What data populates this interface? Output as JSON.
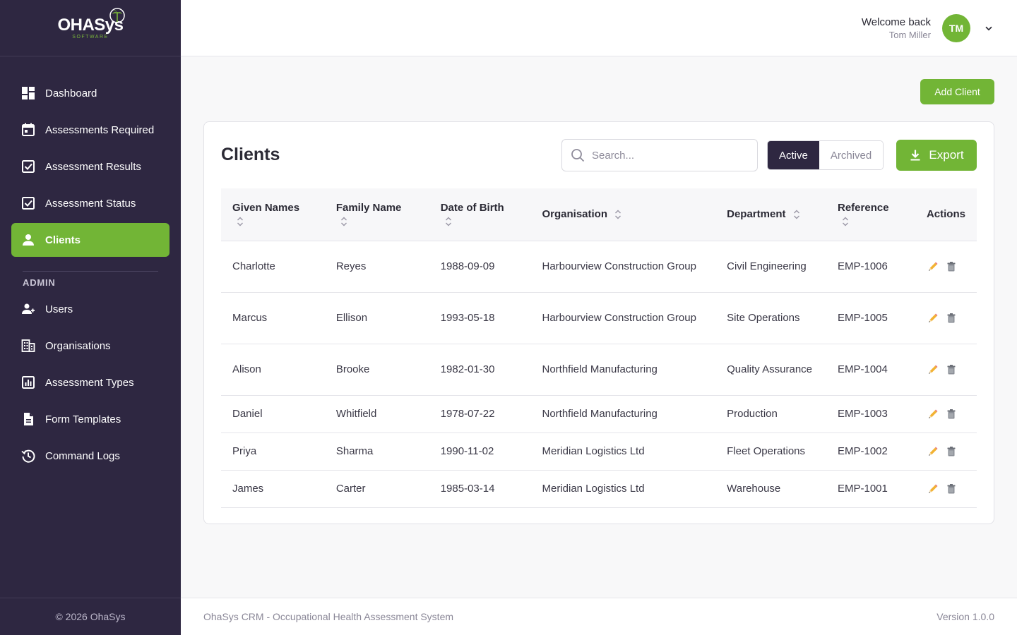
{
  "app": {
    "logo_text": "OHASys",
    "logo_sub": "SOFTWARE",
    "copyright": "© 2026 OhaSys",
    "footer_left": "OhaSys CRM - Occupational Health Assessment System",
    "version": "Version 1.0.0",
    "accent_color": "#72b536",
    "sidebar_color": "#2e2741"
  },
  "sidebar": {
    "items": [
      {
        "label": "Dashboard",
        "icon": "dashboard-icon"
      },
      {
        "label": "Assessments Required",
        "icon": "calendar-icon"
      },
      {
        "label": "Assessment Results",
        "icon": "checkbox-icon"
      },
      {
        "label": "Assessment Status",
        "icon": "checkbox-icon"
      },
      {
        "label": "Clients",
        "icon": "person-icon",
        "active": true
      }
    ],
    "admin_label": "ADMIN",
    "admin_items": [
      {
        "label": "Users",
        "icon": "users-icon"
      },
      {
        "label": "Organisations",
        "icon": "building-icon"
      },
      {
        "label": "Assessment Types",
        "icon": "chart-icon"
      },
      {
        "label": "Form Templates",
        "icon": "document-icon"
      },
      {
        "label": "Command Logs",
        "icon": "history-icon"
      }
    ]
  },
  "header": {
    "welcome": "Welcome back",
    "username": "Tom Miller",
    "avatar_initials": "TM"
  },
  "main": {
    "add_client_label": "Add Client",
    "title": "Clients",
    "search_placeholder": "Search...",
    "toggle": {
      "active": "Active",
      "archived": "Archived",
      "selected": "Active"
    },
    "export_label": "Export",
    "columns": [
      "Given Names",
      "Family Name",
      "Date of Birth",
      "Organisation",
      "Department",
      "Reference",
      "Actions"
    ],
    "rows": [
      {
        "given": "Charlotte",
        "family": "Reyes",
        "dob": "1988-09-09",
        "org": "Harbourview Construction Group",
        "dept": "Civil Engineering",
        "ref": "EMP-1006"
      },
      {
        "given": "Marcus",
        "family": "Ellison",
        "dob": "1993-05-18",
        "org": "Harbourview Construction Group",
        "dept": "Site Operations",
        "ref": "EMP-1005"
      },
      {
        "given": "Alison",
        "family": "Brooke",
        "dob": "1982-01-30",
        "org": "Northfield Manufacturing",
        "dept": "Quality Assurance",
        "ref": "EMP-1004"
      },
      {
        "given": "Daniel",
        "family": "Whitfield",
        "dob": "1978-07-22",
        "org": "Northfield Manufacturing",
        "dept": "Production",
        "ref": "EMP-1003"
      },
      {
        "given": "Priya",
        "family": "Sharma",
        "dob": "1990-11-02",
        "org": "Meridian Logistics Ltd",
        "dept": "Fleet Operations",
        "ref": "EMP-1002"
      },
      {
        "given": "James",
        "family": "Carter",
        "dob": "1985-03-14",
        "org": "Meridian Logistics Ltd",
        "dept": "Warehouse",
        "ref": "EMP-1001"
      }
    ]
  }
}
